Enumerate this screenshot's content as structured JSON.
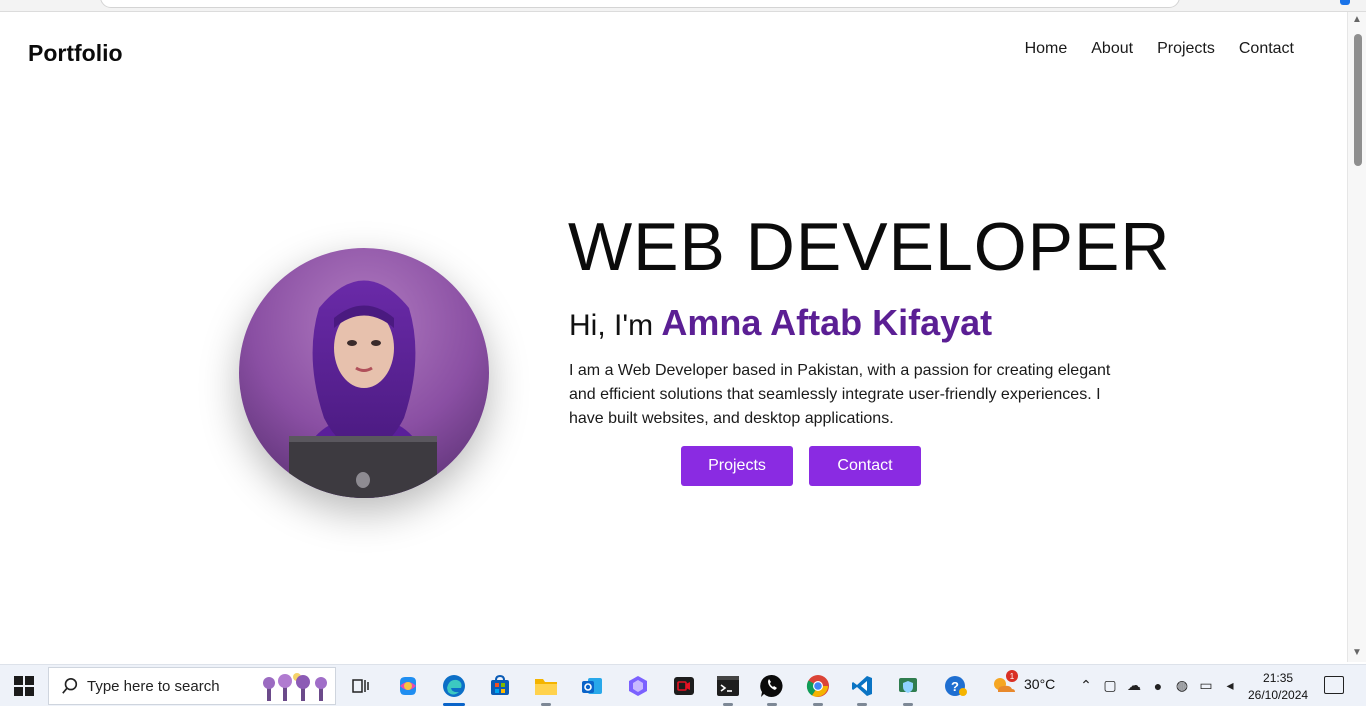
{
  "page": {
    "brand": "Portfolio",
    "nav": [
      "Home",
      "About",
      "Projects",
      "Contact"
    ],
    "hero": {
      "title": "WEB DEVELOPER",
      "greeting_prefix": "Hi, I'm",
      "name": "Amna Aftab Kifayat",
      "description": "I am a Web Developer based in Pakistan, with a passion for creating elegant and efficient solutions that seamlessly integrate user-friendly experiences. I have built websites, and desktop applications.",
      "buttons": [
        "Projects",
        "Contact"
      ]
    },
    "colors": {
      "accent": "#8a2be2",
      "name": "#5b1f94"
    }
  },
  "taskbar": {
    "search_placeholder": "Type here to search",
    "apps": [
      "task-view",
      "copilot",
      "edge",
      "store",
      "file-explorer",
      "outlook",
      "teams",
      "camera-app",
      "terminal",
      "whatsapp",
      "chrome",
      "vscode",
      "defender",
      "get-help"
    ],
    "weather_temp": "30°C",
    "weather_badge": "1",
    "time": "21:35",
    "date": "26/10/2024"
  }
}
